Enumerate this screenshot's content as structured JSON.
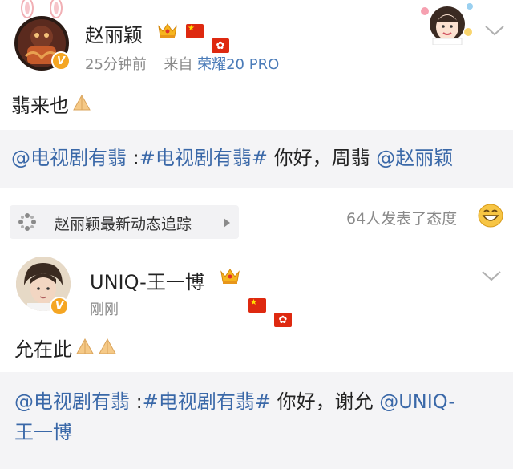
{
  "post1": {
    "username": "赵丽颖",
    "time": "25分钟前",
    "source_prefix": "来自",
    "source": "荣耀20 PRO",
    "content": "翡来也",
    "quote": {
      "mention1": "@电视剧有翡",
      "sep": " :",
      "hashtag": "#电视剧有翡#",
      "text": " 你好，周翡 ",
      "mention2": "@赵丽颖"
    }
  },
  "topic_bar": {
    "label": "赵丽颖最新动态追踪",
    "reaction": "64人发表了态度"
  },
  "post2": {
    "username": "UNIQ-王一博",
    "time": "刚刚",
    "content": "允在此",
    "quote": {
      "mention1": "@电视剧有翡",
      "sep": " :",
      "hashtag": "#电视剧有翡#",
      "text": " 你好，谢允 ",
      "mention2": "@UNIQ-",
      "mention2_cont": "王一博"
    }
  },
  "colors": {
    "link": "#3a68a8",
    "source": "#4a7bb8",
    "meta": "#8a8a8a",
    "quote_bg": "#f4f4f6",
    "verified": "#f5a623"
  },
  "icons": {
    "verified": "verified-v-icon",
    "crown": "crown-icon",
    "flag_cn": "china-flag-icon",
    "flag_hk": "hongkong-flag-icon",
    "pray": "pray-hands-emoji",
    "chevron": "chevron-down-icon",
    "topic": "sparkle-dots-icon",
    "arrow": "play-arrow-icon",
    "smile": "smile-emoji"
  },
  "badges": {
    "verified_letter": "V"
  }
}
